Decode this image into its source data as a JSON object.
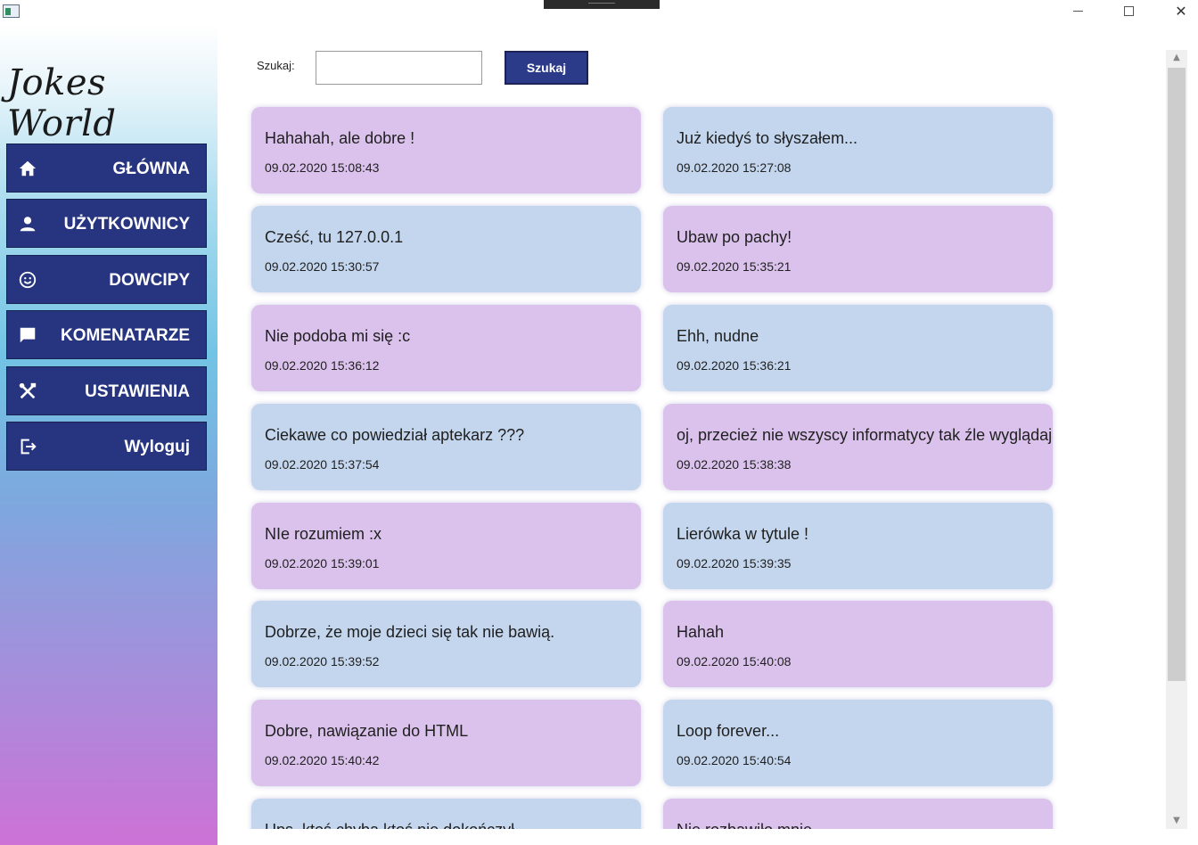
{
  "app": {
    "logo": "Jokes World"
  },
  "window": {
    "minimize": "—",
    "maximize": "□",
    "close": "✕"
  },
  "sidebar": {
    "items": [
      {
        "label": "GŁÓWNA",
        "icon": "home-icon"
      },
      {
        "label": "UŻYTKOWNICY",
        "icon": "user-icon"
      },
      {
        "label": "DOWCIPY",
        "icon": "smiley-icon"
      },
      {
        "label": "KOMENATARZE",
        "icon": "comment-icon"
      },
      {
        "label": "USTAWIENIA",
        "icon": "tools-icon"
      },
      {
        "label": "Wyloguj",
        "icon": "logout-icon"
      }
    ]
  },
  "search": {
    "label": "Szukaj:",
    "value": "",
    "button": "Szukaj"
  },
  "comments": [
    {
      "text": "Hahahah, ale dobre !",
      "date": "09.02.2020 15:08:43",
      "color": "pink"
    },
    {
      "text": "Już kiedyś to słyszałem...",
      "date": "09.02.2020 15:27:08",
      "color": "blue"
    },
    {
      "text": "Cześć, tu 127.0.0.1",
      "date": "09.02.2020 15:30:57",
      "color": "blue"
    },
    {
      "text": "Ubaw po pachy!",
      "date": "09.02.2020 15:35:21",
      "color": "pink"
    },
    {
      "text": "Nie podoba mi się :c",
      "date": "09.02.2020 15:36:12",
      "color": "pink"
    },
    {
      "text": "Ehh, nudne",
      "date": "09.02.2020 15:36:21",
      "color": "blue"
    },
    {
      "text": "Ciekawe co powiedział aptekarz ???",
      "date": "09.02.2020 15:37:54",
      "color": "blue"
    },
    {
      "text": "oj, przecież nie wszyscy informatycy tak źle wyglądają",
      "date": "09.02.2020 15:38:38",
      "color": "pink"
    },
    {
      "text": "NIe rozumiem :x",
      "date": "09.02.2020 15:39:01",
      "color": "pink"
    },
    {
      "text": "Lierówka w tytule !",
      "date": "09.02.2020 15:39:35",
      "color": "blue"
    },
    {
      "text": "Dobrze, że moje dzieci się tak nie bawią.",
      "date": "09.02.2020 15:39:52",
      "color": "blue"
    },
    {
      "text": "Hahah",
      "date": "09.02.2020 15:40:08",
      "color": "pink"
    },
    {
      "text": "Dobre, nawiązanie do HTML",
      "date": "09.02.2020 15:40:42",
      "color": "pink"
    },
    {
      "text": "Loop forever...",
      "date": "09.02.2020 15:40:54",
      "color": "blue"
    },
    {
      "text": "Ups, ktoś chyba ktoś nie dokończył",
      "date": "",
      "color": "blue"
    },
    {
      "text": "Nie rozbawiło mnie",
      "date": "",
      "color": "pink"
    }
  ],
  "colors": {
    "pink": "#dbc2ec",
    "blue": "#c3d6ee",
    "nav": "#273580"
  }
}
